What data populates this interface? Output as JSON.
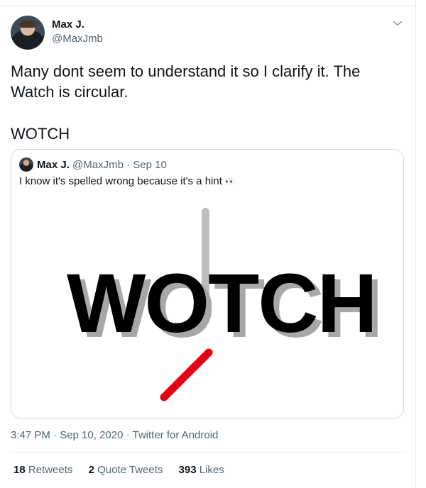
{
  "tweet": {
    "display_name": "Max J.",
    "handle": "@MaxJmb",
    "text_line1": "Many dont seem to understand it so I clarify it. The Watch is circular.",
    "text_line2": "WOTCH",
    "timestamp": "3:47 PM · Sep 10, 2020",
    "source": "Twitter for Android",
    "separator": " · ",
    "stats": {
      "retweets_count": "18",
      "retweets_label": "Retweets",
      "quotes_count": "2",
      "quotes_label": "Quote Tweets",
      "likes_count": "393",
      "likes_label": "Likes"
    }
  },
  "quoted": {
    "display_name": "Max J.",
    "handle": "@MaxJmb",
    "date": "Sep 10",
    "dot": " · ",
    "text": "I know it's spelled wrong because it's a hint",
    "emoji": "👀",
    "image_word": "WOTCH"
  },
  "icons": {
    "more": "chevron-down-icon",
    "eyes": "eyes-emoji-icon"
  },
  "colors": {
    "clock_hand_red": "#e60012",
    "clock_hand_gray": "#bdbdbd",
    "muted_text": "#536471"
  }
}
